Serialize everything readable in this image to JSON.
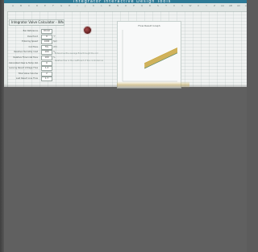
{
  "window": {
    "title": "Integrator Interactive Design Tools"
  },
  "spreadsheet": {
    "column_letters": [
      "A",
      "B",
      "C",
      "D",
      "E",
      "F",
      "G",
      "H",
      "I",
      "J",
      "K",
      "L",
      "M",
      "N",
      "O",
      "P",
      "Q",
      "R",
      "S",
      "T",
      "U",
      "V",
      "W",
      "X",
      "Y",
      "Z",
      "AA",
      "AB",
      "AC",
      "AD"
    ],
    "calculator_title": "Integrator Valve Calculator - Wholly Queasy",
    "parameters": [
      {
        "label": "Bar Reference",
        "value": "D0.02",
        "unit": ""
      },
      {
        "label": "Dew Point",
        "value": "0",
        "unit": "°F"
      },
      {
        "label": "Entering Speed",
        "value": "1000",
        "unit": "fpm"
      },
      {
        "label": "Coil Face",
        "value": "5%",
        "unit": "cfm"
      },
      {
        "label": "Relative Humidity Inlet",
        "value": "100",
        "unit": "%"
      },
      {
        "label": "Relative Flow Inlet Face",
        "value": "100",
        "unit": "%"
      },
      {
        "label": "Calculated Dew & Temp Value",
        "value": "0",
        "unit": ""
      },
      {
        "label": "Leaving Result Voltage Flow",
        "value": "1.3",
        "unit": ""
      },
      {
        "label": "Total Valve Volume",
        "value": "2",
        "unit": ""
      },
      {
        "label": "Last Result Line Flow",
        "value": "1.7",
        "unit": ""
      }
    ],
    "notes": [
      "Entered as the average flow through the coil",
      "Relative flow is the coefficient of the controlled valve"
    ]
  },
  "chart_data": {
    "type": "area",
    "title": "Flow Result Graph",
    "x": [
      0,
      1,
      2,
      3,
      4,
      5,
      6
    ],
    "series": [
      {
        "values": [
          14,
          16,
          18,
          20,
          22,
          24,
          26
        ]
      },
      {
        "values": [
          10,
          12,
          14,
          16,
          18,
          20,
          22
        ]
      }
    ],
    "xlim": [
      0,
      10
    ],
    "ylim": [
      0,
      40
    ],
    "grid": false,
    "colors": [
      "#c9a640",
      "#5f8a6d"
    ]
  },
  "colors": {
    "header": "#2d7a96",
    "sheet": "#f0f2f1",
    "background": "#606060"
  }
}
